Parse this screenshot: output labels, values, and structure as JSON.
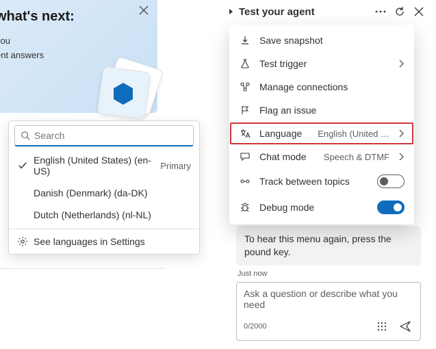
{
  "promo": {
    "title": "what's next:",
    "line1": "you",
    "line2": "ent answers"
  },
  "lang_picker": {
    "search_placeholder": "Search",
    "items": [
      {
        "label": "English (United States) (en-US)",
        "selected": true,
        "badge": "Primary"
      },
      {
        "label": "Danish (Denmark) (da-DK)",
        "selected": false,
        "badge": ""
      },
      {
        "label": "Dutch (Netherlands) (nl-NL)",
        "selected": false,
        "badge": ""
      }
    ],
    "footer": "See languages in Settings"
  },
  "panel": {
    "title": "Test your agent"
  },
  "menu": {
    "save_snapshot": "Save snapshot",
    "test_trigger": "Test trigger",
    "manage_connections": "Manage connections",
    "flag_issue": "Flag an issue",
    "language_label": "Language",
    "language_value": "English (United …",
    "chat_mode_label": "Chat mode",
    "chat_mode_value": "Speech & DTMF",
    "track_topics": "Track between topics",
    "debug_mode": "Debug mode"
  },
  "chat": {
    "last_msg": "To hear this menu again, press the pound key.",
    "timestamp": "Just now",
    "placeholder": "Ask a question or describe what you need",
    "counter": "0/2000"
  }
}
